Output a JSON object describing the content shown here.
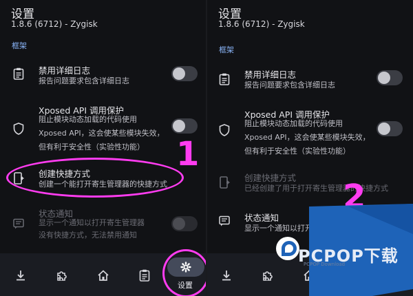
{
  "left": {
    "title": "设置",
    "subtitle": "1.8.6 (6712) - Zygisk",
    "section": "框架",
    "items": [
      {
        "title": "禁用详细日志",
        "desc": [
          "报告问题要求包含详细日志"
        ],
        "icon": "clipboard-list-icon",
        "toggle": "off"
      },
      {
        "title": "Xposed API 调用保护",
        "desc": [
          "阻止模块动态加载的代码使用",
          "Xposed API，这会使某些模块失效，",
          "但有利于安全性（实验性功能）"
        ],
        "icon": "shield-icon",
        "toggle": "off"
      },
      {
        "title": "创建快捷方式",
        "desc": [
          "创建一个能打开寄生管理器的快捷方式"
        ],
        "icon": "add-to-home-icon"
      },
      {
        "title": "状态通知",
        "desc": [
          "显示一个通知以打开寄生管理器",
          "没有快捷方式，无法禁用通知"
        ],
        "icon": "notification-icon",
        "toggle": "disabled"
      }
    ],
    "nav": {
      "active_label": "设置"
    },
    "annotation_number": "1"
  },
  "right": {
    "title": "设置",
    "subtitle": "1.8.6 (6712) - Zygisk",
    "section": "框架",
    "items": [
      {
        "title": "禁用详细日志",
        "desc": [
          "报告问题要求包含详细日志"
        ],
        "icon": "clipboard-list-icon",
        "toggle": "off"
      },
      {
        "title": "Xposed API 调用保护",
        "desc": [
          "阻止模块动态加载的代码使用",
          "Xposed API，这会使某些模块失效，",
          "但有利于安全性（实验性功能）"
        ],
        "icon": "shield-icon",
        "toggle": "off"
      },
      {
        "title": "创建快捷方式",
        "desc": [
          "已经创建了用于打开寄生管理器的快捷方式"
        ],
        "icon": "add-to-home-icon"
      },
      {
        "title": "状态通知",
        "desc": [
          "显示一个通知以打开寄生管理"
        ],
        "icon": "notification-icon"
      }
    ],
    "annotation_number": "2"
  },
  "watermark": {
    "text": "PCPOP下载",
    "sub": "PCPOP Download"
  },
  "colors": {
    "accent": "#8ab4f8",
    "annotation": "#ff3cf0",
    "watermark_blue": "#1e63b8"
  }
}
